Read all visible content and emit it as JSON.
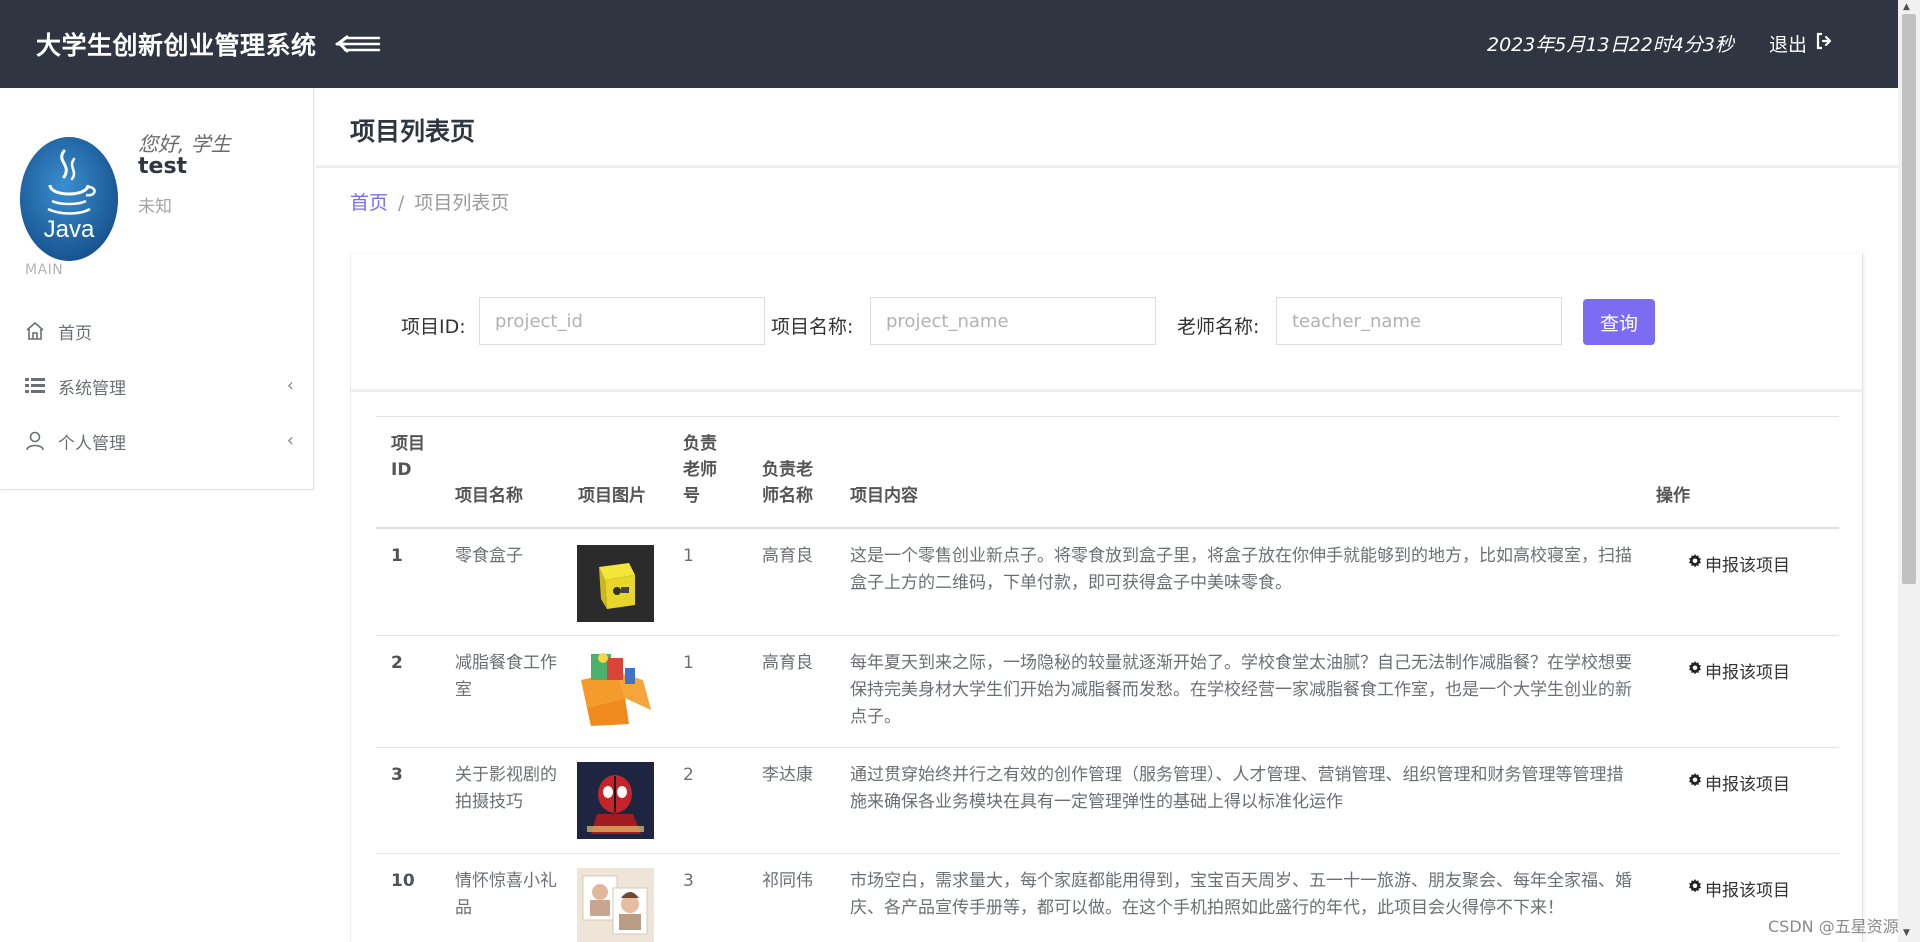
{
  "header": {
    "title": "大学生创新创业管理系统",
    "datetime": "2023年5月13日22时4分3秒",
    "logout_label": "退出"
  },
  "sidebar": {
    "avatar_text": "Java",
    "greeting": "您好, 学生",
    "username": "test",
    "status": "未知",
    "section_label": "MAIN",
    "items": [
      {
        "label": "首页",
        "icon": "home-icon"
      },
      {
        "label": "系统管理",
        "icon": "list-icon"
      },
      {
        "label": "个人管理",
        "icon": "user-icon"
      }
    ]
  },
  "page": {
    "title": "项目列表页",
    "breadcrumb": {
      "home": "首页",
      "current": "项目列表页"
    }
  },
  "search": {
    "project_id_label": "项目ID:",
    "project_id_placeholder": "project_id",
    "project_name_label": "项目名称:",
    "project_name_placeholder": "project_name",
    "teacher_name_label": "老师名称:",
    "teacher_name_placeholder": "teacher_name",
    "submit_label": "查询"
  },
  "table": {
    "headers": [
      "项目\nID",
      "项目名称",
      "项目图片",
      "负责\n老师\n号",
      "负责老\n师名称",
      "项目内容",
      "操作"
    ],
    "action_label": "申报该项目",
    "rows": [
      {
        "id": "1",
        "name": "零食盒子",
        "teacher_no": "1",
        "teacher_name": "高育良",
        "content": "这是一个零售创业新点子。将零食放到盒子里，将盒子放在你伸手就能够到的地方，比如高校寝室，扫描盒子上方的二维码，下单付款，即可获得盒子中美味零食。",
        "image": "snack-box"
      },
      {
        "id": "2",
        "name": "减脂餐食工作室",
        "teacher_no": "1",
        "teacher_name": "高育良",
        "content": "每年夏天到来之际，一场隐秘的较量就逐渐开始了。学校食堂太油腻？自己无法制作减脂餐？在学校想要保持完美身材大学生们开始为减脂餐而发愁。在学校经营一家减脂餐食工作室，也是一个大学生创业的新点子。",
        "image": "diet-meal"
      },
      {
        "id": "3",
        "name": "关于影视剧的拍摄技巧",
        "teacher_no": "2",
        "teacher_name": "李达康",
        "content": "通过贯穿始终并行之有效的创作管理（服务管理）、人才管理、营销管理、组织管理和财务管理等管理措施来确保各业务模块在具有一定管理弹性的基础上得以标准化运作",
        "image": "movie-poster"
      },
      {
        "id": "10",
        "name": "情怀惊喜小礼品",
        "teacher_no": "3",
        "teacher_name": "祁同伟",
        "content": "市场空白，需求量大，每个家庭都能用得到，宝宝百天周岁、五一十一旅游、朋友聚会、每年全家福、婚庆、各产品宣传手册等，都可以做。在这个手机拍照如此盛行的年代，此项目会火得停不下来！",
        "image": "gift-photo"
      }
    ]
  },
  "watermark": "CSDN @五星资源",
  "colors": {
    "header_bg": "#2f3541",
    "accent": "#7b6cf2"
  }
}
